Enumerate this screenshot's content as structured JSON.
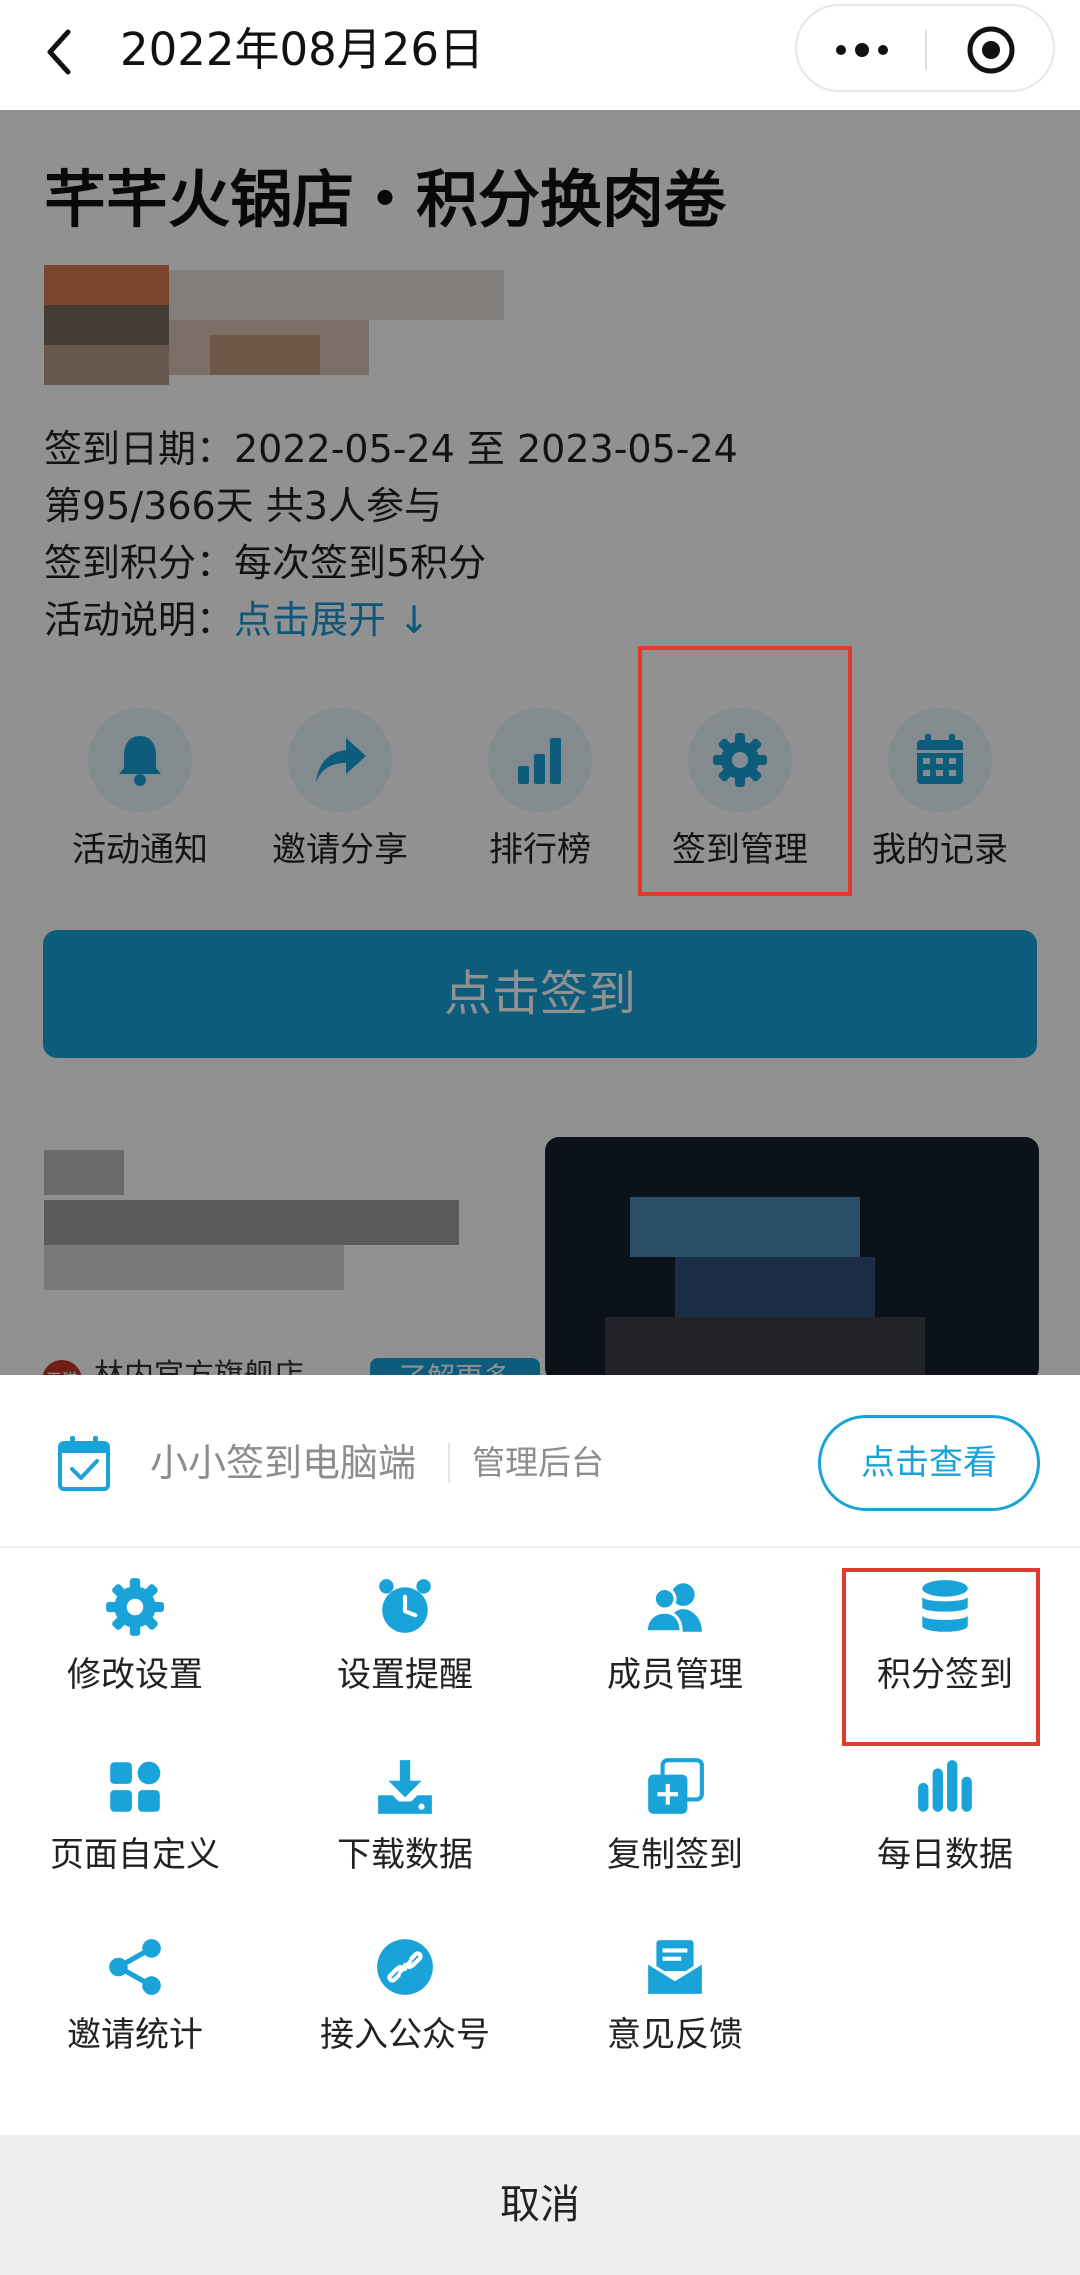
{
  "navbar": {
    "title": "2022年08月26日",
    "back_icon": "chevron-left-icon",
    "more_icon": "more-dots-icon",
    "close_icon": "target-circle-icon"
  },
  "activity": {
    "title": "芊芊火锅店・积分换肉卷",
    "date_line": "签到日期：2022-05-24 至 2023-05-24",
    "progress_line": "第95/366天 共3人参与",
    "points_line": "签到积分：每次签到5积分",
    "desc_label": "活动说明：",
    "desc_link": "点击展开 ↓"
  },
  "features": [
    {
      "label": "活动通知",
      "icon": "bell-icon"
    },
    {
      "label": "邀请分享",
      "icon": "share-arrow-icon"
    },
    {
      "label": "排行榜",
      "icon": "bar-chart-icon"
    },
    {
      "label": "签到管理",
      "icon": "gear-icon"
    },
    {
      "label": "我的记录",
      "icon": "calendar-icon"
    }
  ],
  "checkin_button": "点击签到",
  "ad": {
    "store_badge": "天猫",
    "store_name": "林内官方旗舰店",
    "more_label": "了解更多"
  },
  "sheet": {
    "pc_title": "小小签到电脑端",
    "pc_admin": "管理后台",
    "view_button": "点击查看",
    "items": [
      {
        "label": "修改设置",
        "icon": "gear-icon"
      },
      {
        "label": "设置提醒",
        "icon": "alarm-clock-icon"
      },
      {
        "label": "成员管理",
        "icon": "members-icon"
      },
      {
        "label": "积分签到",
        "icon": "database-icon"
      },
      {
        "label": "页面自定义",
        "icon": "grid-blocks-icon"
      },
      {
        "label": "下载数据",
        "icon": "download-icon"
      },
      {
        "label": "复制签到",
        "icon": "copy-plus-icon"
      },
      {
        "label": "每日数据",
        "icon": "bar-chart-icon"
      },
      {
        "label": "邀请统计",
        "icon": "share-nodes-icon"
      },
      {
        "label": "接入公众号",
        "icon": "link-circle-icon"
      },
      {
        "label": "意见反馈",
        "icon": "mail-open-icon"
      }
    ],
    "cancel_label": "取消"
  },
  "colors": {
    "accent": "#1aa3d9",
    "highlight": "#e23b2e",
    "overlay": "rgba(0,0,0,0.43)"
  }
}
